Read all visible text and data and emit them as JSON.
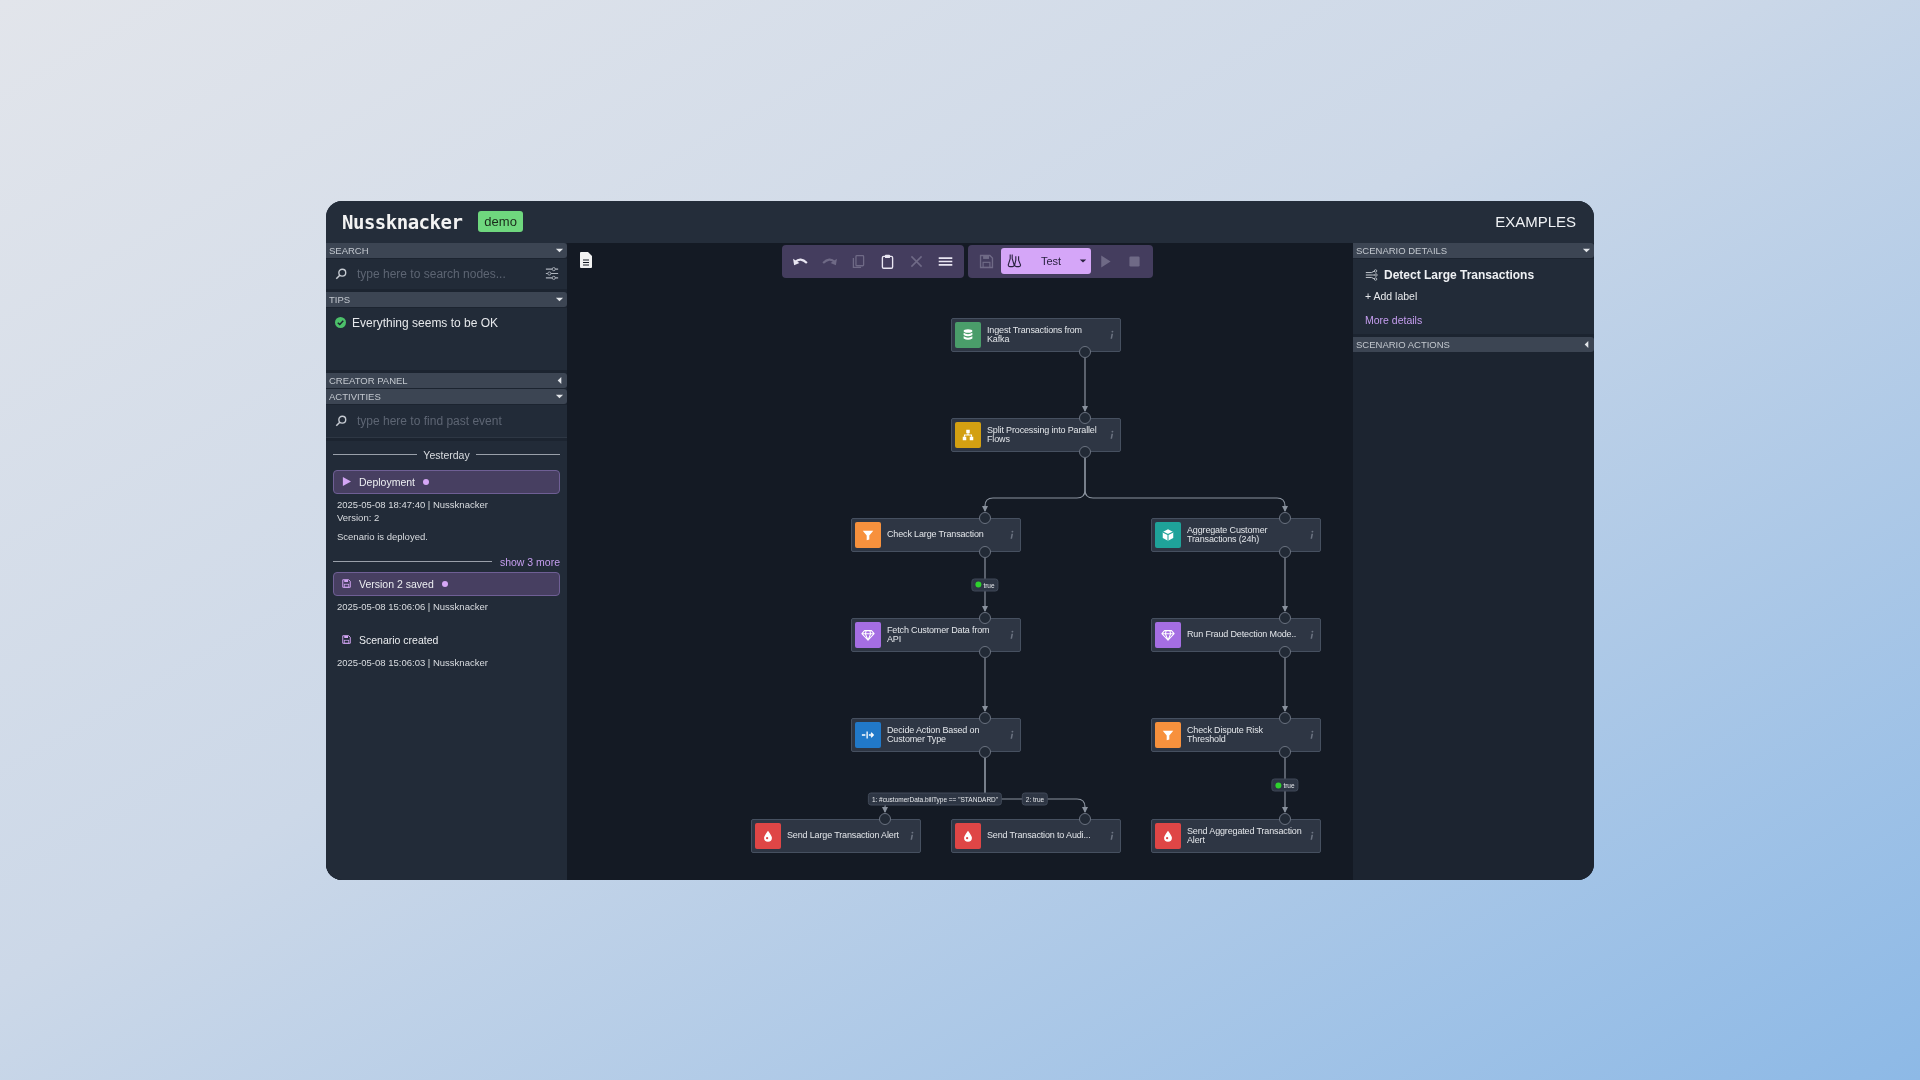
{
  "header": {
    "logo": "Nussknacker",
    "env_badge": "demo",
    "nav_link": "EXAMPLES"
  },
  "left_panel": {
    "search": {
      "title": "SEARCH",
      "expanded": true,
      "placeholder": "type here to search nodes..."
    },
    "tips": {
      "title": "TIPS",
      "expanded": true,
      "message": "Everything seems to be OK"
    },
    "creator_panel": {
      "title": "CREATOR PANEL",
      "expanded": false
    },
    "activities": {
      "title": "ACTIVITIES",
      "expanded": true,
      "placeholder": "type here to find past event",
      "day": "Yesterday",
      "items": [
        {
          "kind": "deployment",
          "title": "Deployment",
          "highlighted": true,
          "meta": "2025-05-08 18:47:40 | Nussknacker",
          "version": "Version: 2",
          "comment": "Scenario is deployed."
        },
        {
          "kind": "show_more",
          "title": "show 3 more"
        },
        {
          "kind": "saved",
          "title": "Version 2 saved",
          "highlighted": true,
          "meta": "2025-05-08 15:06:06 | Nussknacker"
        },
        {
          "kind": "saved",
          "title": "Scenario created",
          "highlighted": false,
          "meta": "2025-05-08 15:06:03 | Nussknacker"
        }
      ]
    }
  },
  "toolbar": {
    "buttons": [
      {
        "kind": "undo",
        "disabled": false
      },
      {
        "kind": "redo",
        "disabled": true
      },
      {
        "kind": "copy",
        "disabled": true
      },
      {
        "kind": "paste",
        "disabled": false
      },
      {
        "kind": "delete",
        "disabled": true
      },
      {
        "kind": "layout",
        "disabled": false
      }
    ],
    "actions": [
      {
        "kind": "save",
        "disabled": true
      },
      {
        "kind": "test",
        "label": "Test",
        "disabled": false
      },
      {
        "kind": "deploy",
        "disabled": true
      },
      {
        "kind": "cancel",
        "disabled": true
      }
    ]
  },
  "graph": {
    "nodes": [
      {
        "kind": "source",
        "label": "Ingest Transactions from Kafka"
      },
      {
        "kind": "split",
        "label": "Split Processing into Parallel Flows"
      },
      {
        "kind": "filter",
        "label": "Check Large Transaction"
      },
      {
        "kind": "aggregate",
        "label": "Aggregate Customer Transactions (24h)"
      },
      {
        "kind": "enricher",
        "label": "Fetch Customer Data from API"
      },
      {
        "kind": "enricher",
        "label": "Run Fraud Detection Mode.."
      },
      {
        "kind": "switch",
        "label": "Decide Action Based on Customer Type"
      },
      {
        "kind": "filter",
        "label": "Check Dispute Risk Threshold"
      },
      {
        "kind": "sink",
        "label": "Send Large Transaction Alert"
      },
      {
        "kind": "sink",
        "label": "Send Transaction to Audi..."
      },
      {
        "kind": "sink",
        "label": "Send Aggregated Transaction Alert"
      }
    ],
    "edges": [
      {
        "kind": "plain"
      },
      {
        "kind": "plain"
      },
      {
        "kind": "plain"
      },
      {
        "kind": "filter",
        "label": "true"
      },
      {
        "kind": "plain"
      },
      {
        "kind": "plain"
      },
      {
        "kind": "plain"
      },
      {
        "kind": "switch",
        "label": "1: #customerData.billType == \"STANDARD\""
      },
      {
        "kind": "switch",
        "label": "2: true"
      },
      {
        "kind": "filter",
        "label": "true"
      }
    ]
  },
  "right_panel": {
    "details": {
      "title": "SCENARIO DETAILS",
      "expanded": true,
      "name": "Detect Large Transactions",
      "add_label": "+ Add label",
      "more_link": "More details"
    },
    "actions": {
      "title": "SCENARIO ACTIONS",
      "expanded": false
    }
  }
}
